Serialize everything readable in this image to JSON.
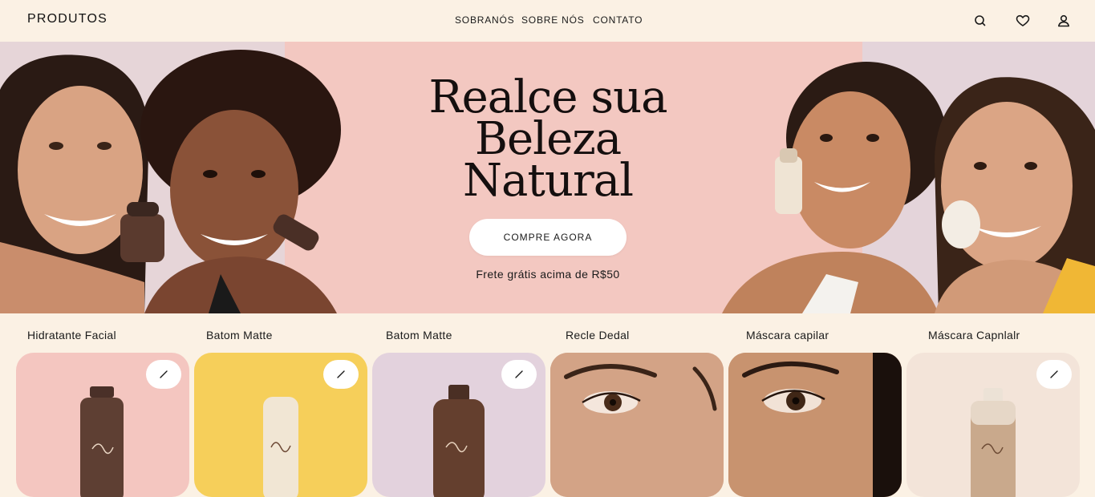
{
  "nav": {
    "brand": "PRODUTOS",
    "menu": [
      "SOBRANÓS",
      "SOBRE NÓS",
      "CONTATO"
    ],
    "icons": [
      "search-icon",
      "heart-icon",
      "user-icon"
    ]
  },
  "hero": {
    "title_lines": [
      "Realce sua",
      "Beleza",
      "Natural"
    ],
    "cta_label": "COMPRE AGORA",
    "shipping_note": "Frete grátis acima de R$50"
  },
  "products": [
    {
      "name": "Hidratante Facial",
      "bg": "#f4c6c0",
      "favorite": true
    },
    {
      "name": "Batom Matte",
      "bg": "#f6cf5a",
      "favorite": true
    },
    {
      "name": "Batom Matte",
      "bg": "#e3d2dd",
      "favorite": true
    },
    {
      "name": "Recle Dedal",
      "bg": "#c99a80",
      "favorite": false
    },
    {
      "name": "Máscara capilar",
      "bg": "#b88468",
      "favorite": false
    },
    {
      "name": "Máscara Capnlalr",
      "bg": "#f3e4d9",
      "favorite": true
    }
  ],
  "colors": {
    "background": "#fbf1e4",
    "hero_pink": "#f3c8c1",
    "text": "#1b1414",
    "button": "#ffffff"
  }
}
